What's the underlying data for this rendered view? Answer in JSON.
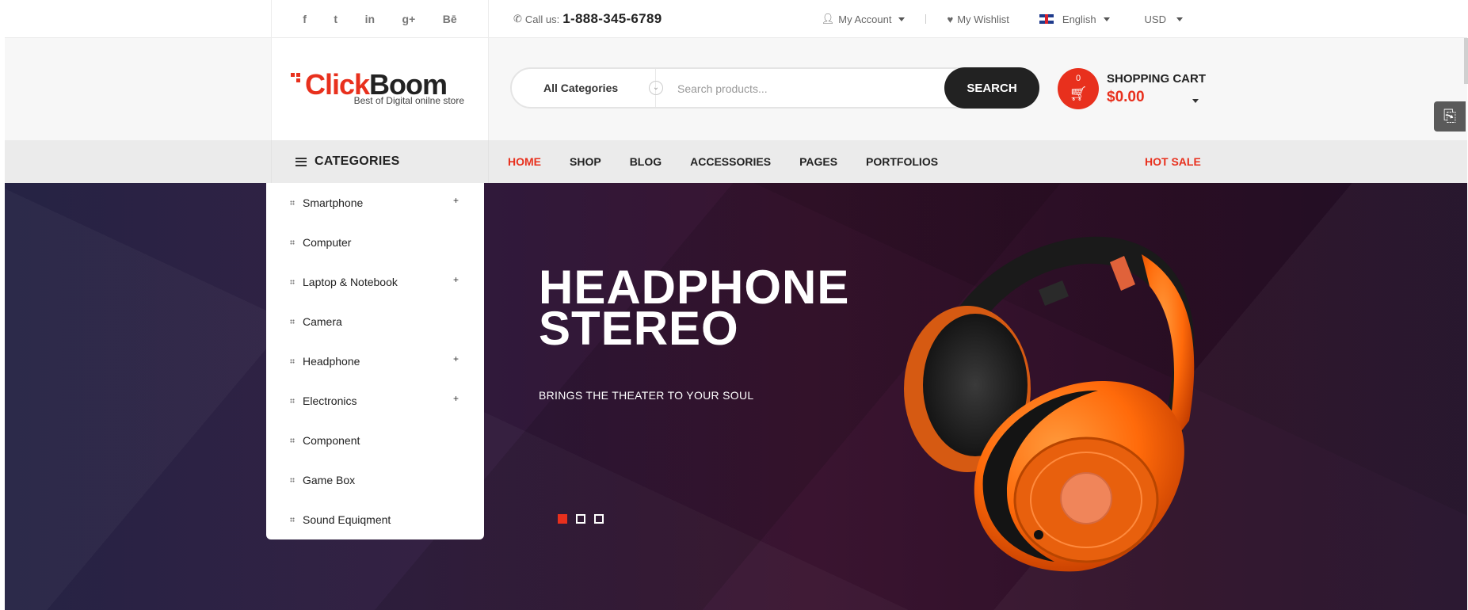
{
  "topbar": {
    "social_icons": [
      "facebook-icon",
      "twitter-icon",
      "linkedin-icon",
      "google-plus-icon",
      "behance-icon"
    ],
    "social_glyphs": [
      "f",
      "t",
      "in",
      "g+",
      "Bē"
    ],
    "call_label": "Call us:",
    "phone": "1-888-345-6789",
    "account": "My Account",
    "wishlist": "My Wishlist",
    "language": "English",
    "currency": "USD"
  },
  "header": {
    "logo_click": "Click",
    "logo_boom": "Boom",
    "tagline": "Best of Digital onilne store",
    "search": {
      "category": "All Categories",
      "placeholder": "Search products...",
      "button": "SEARCH"
    },
    "cart": {
      "count": "0",
      "title": "SHOPPING CART",
      "total": "$0.00"
    }
  },
  "nav": {
    "categories_label": "CATEGORIES",
    "menu": [
      {
        "label": "HOME",
        "active": true
      },
      {
        "label": "SHOP",
        "active": false
      },
      {
        "label": "BLOG",
        "active": false
      },
      {
        "label": "ACCESSORIES",
        "active": false
      },
      {
        "label": "PAGES",
        "active": false
      },
      {
        "label": "PORTFOLIOS",
        "active": false
      }
    ],
    "hot_sale": "HOT SALE"
  },
  "categories": [
    {
      "label": "Smartphone",
      "expand": "+"
    },
    {
      "label": "Computer",
      "expand": ""
    },
    {
      "label": "Laptop & Notebook",
      "expand": "+"
    },
    {
      "label": "Camera",
      "expand": ""
    },
    {
      "label": "Headphone",
      "expand": "+"
    },
    {
      "label": "Electronics",
      "expand": "+"
    },
    {
      "label": "Component",
      "expand": ""
    },
    {
      "label": "Game Box",
      "expand": ""
    },
    {
      "label": "Sound Equiqment",
      "expand": ""
    }
  ],
  "hero": {
    "title_line1": "HEADPHONE",
    "title_line2": "STEREO",
    "subtitle": "BRINGS THE THEATER TO YOUR SOUL",
    "slides": 3,
    "active_slide": 1
  },
  "colors": {
    "accent": "#e8301d",
    "dark": "#222222",
    "nav_bg": "#ebebeb"
  }
}
